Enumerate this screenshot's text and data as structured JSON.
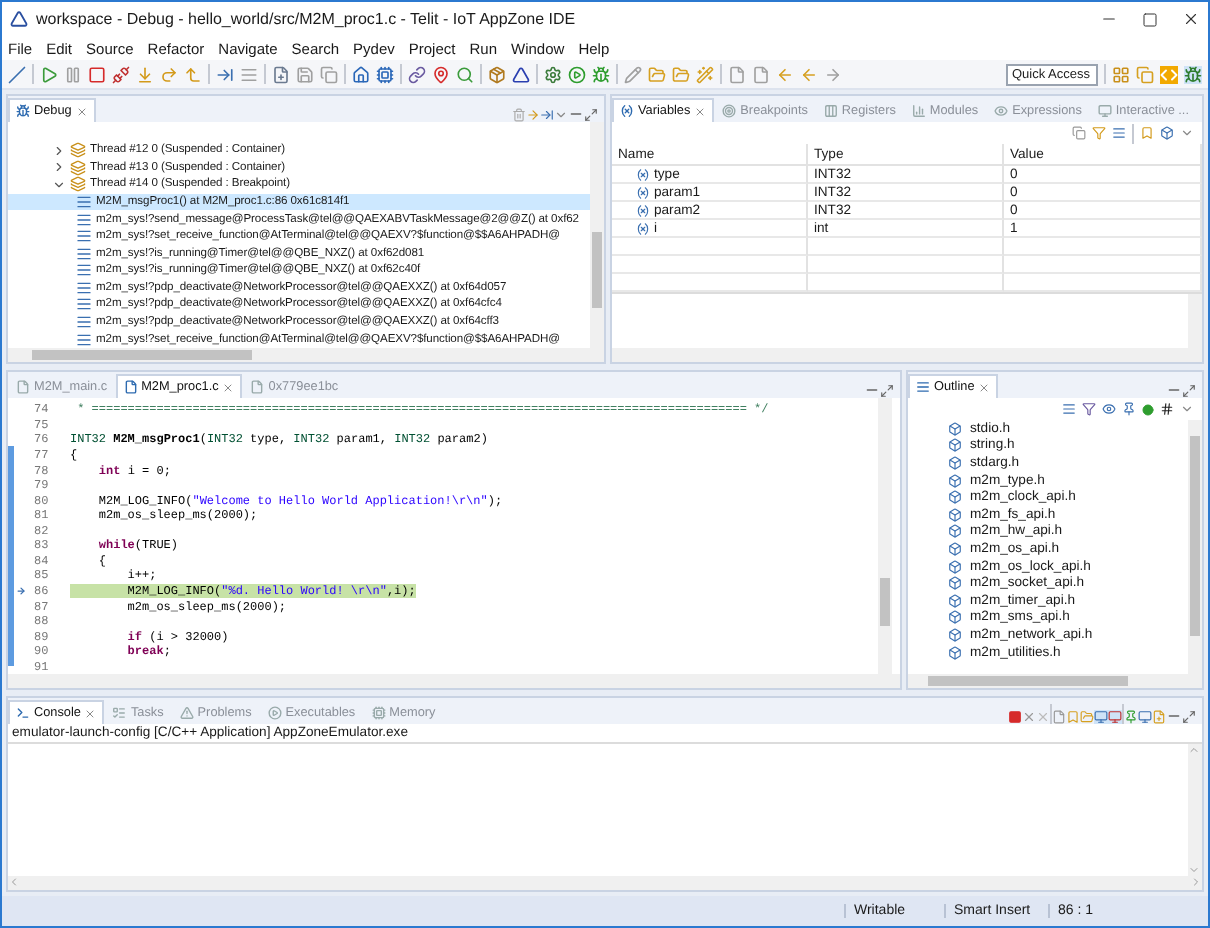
{
  "window": {
    "title": "workspace - Debug - hello_world/src/M2M_proc1.c - Telit - IoT AppZone IDE"
  },
  "menu": [
    "File",
    "Edit",
    "Source",
    "Refactor",
    "Navigate",
    "Search",
    "Pydev",
    "Project",
    "Run",
    "Window",
    "Help"
  ],
  "quick_access": {
    "placeholder": "Quick Access"
  },
  "debug_view": {
    "tabs": [
      {
        "label": "Debug",
        "selected": true
      }
    ],
    "threads": [
      {
        "label": "Thread #12 0 (Suspended : Container)",
        "expanded": false
      },
      {
        "label": "Thread #13 0 (Suspended : Container)",
        "expanded": false
      },
      {
        "label": "Thread #14 0 (Suspended : Breakpoint)",
        "expanded": true,
        "children": [
          {
            "label": "M2M_msgProc1() at M2M_proc1.c:86 0x61c814f1",
            "selected": true
          },
          {
            "label": "m2m_sys!?send_message@ProcessTask@tel@@QAEXABVTaskMessage@2@@Z() at 0xf62",
            "selected": false
          },
          {
            "label": "m2m_sys!?set_receive_function@AtTerminal@tel@@QAEXV?$function@$$A6AHPADH@",
            "selected": false
          },
          {
            "label": "m2m_sys!?is_running@Timer@tel@@QBE_NXZ() at 0xf62d081",
            "selected": false
          },
          {
            "label": "m2m_sys!?is_running@Timer@tel@@QBE_NXZ() at 0xf62c40f",
            "selected": false
          },
          {
            "label": "m2m_sys!?pdp_deactivate@NetworkProcessor@tel@@QAEXXZ() at 0xf64d057",
            "selected": false
          },
          {
            "label": "m2m_sys!?pdp_deactivate@NetworkProcessor@tel@@QAEXXZ() at 0xf64cfc4",
            "selected": false
          },
          {
            "label": "m2m_sys!?pdp_deactivate@NetworkProcessor@tel@@QAEXXZ() at 0xf64cff3",
            "selected": false
          },
          {
            "label": "m2m_sys!?set_receive_function@AtTerminal@tel@@QAEXV?$function@$$A6AHPADH@",
            "selected": false
          }
        ]
      }
    ]
  },
  "variables_view": {
    "tabs": [
      {
        "label": "Variables",
        "selected": true
      },
      {
        "label": "Breakpoints",
        "selected": false
      },
      {
        "label": "Registers",
        "selected": false
      },
      {
        "label": "Modules",
        "selected": false
      },
      {
        "label": "Expressions",
        "selected": false
      },
      {
        "label": "Interactive ...",
        "selected": false
      }
    ],
    "columns": [
      "Name",
      "Type",
      "Value"
    ],
    "rows": [
      {
        "name": "type",
        "type": "INT32",
        "value": "0"
      },
      {
        "name": "param1",
        "type": "INT32",
        "value": "0"
      },
      {
        "name": "param2",
        "type": "INT32",
        "value": "0"
      },
      {
        "name": "i",
        "type": "int",
        "value": "1"
      }
    ]
  },
  "editor": {
    "tabs": [
      {
        "label": "M2M_main.c",
        "selected": false
      },
      {
        "label": "M2M_proc1.c",
        "selected": true
      },
      {
        "label": "0x779ee1bc",
        "selected": false
      }
    ],
    "lines": [
      {
        "number": "74",
        "current": false,
        "segments": [
          {
            "text": " * =========================================================================================== */",
            "kind": "comment"
          }
        ]
      },
      {
        "number": "75",
        "current": false
      },
      {
        "number": "76",
        "current": false,
        "segments": [
          {
            "text": "INT32 ",
            "kind": "type"
          },
          {
            "text": "M2M_msgProc1",
            "kind": "bold"
          },
          {
            "text": "(",
            "kind": "plain"
          },
          {
            "text": "INT32",
            "kind": "type"
          },
          {
            "text": " type, ",
            "kind": "plain"
          },
          {
            "text": "INT32",
            "kind": "type"
          },
          {
            "text": " param1, ",
            "kind": "plain"
          },
          {
            "text": "INT32",
            "kind": "type"
          },
          {
            "text": " param2)",
            "kind": "plain"
          }
        ]
      },
      {
        "number": "77",
        "current": false,
        "segments": [
          {
            "text": "{",
            "kind": "plain"
          }
        ]
      },
      {
        "number": "78",
        "current": false,
        "segments": [
          {
            "text": "    int",
            "kind": "keyword"
          },
          {
            "text": " i = 0;",
            "kind": "plain"
          }
        ]
      },
      {
        "number": "79",
        "current": false
      },
      {
        "number": "80",
        "current": false,
        "segments": [
          {
            "text": "    M2M_LOG_INFO(",
            "kind": "plain"
          },
          {
            "text": "\"Welcome to Hello World Application!\\r\\n\"",
            "kind": "string"
          },
          {
            "text": ");",
            "kind": "plain"
          }
        ]
      },
      {
        "number": "81",
        "current": false,
        "segments": [
          {
            "text": "    m2m_os_sleep_ms(2000);",
            "kind": "plain"
          }
        ]
      },
      {
        "number": "82",
        "current": false
      },
      {
        "number": "83",
        "current": false,
        "segments": [
          {
            "text": "    while",
            "kind": "keyword"
          },
          {
            "text": "(TRUE)",
            "kind": "plain"
          }
        ]
      },
      {
        "number": "84",
        "current": false,
        "segments": [
          {
            "text": "    {",
            "kind": "plain"
          }
        ]
      },
      {
        "number": "85",
        "current": false,
        "segments": [
          {
            "text": "        i++;",
            "kind": "plain"
          }
        ]
      },
      {
        "number": "86",
        "current": true,
        "segments": [
          {
            "text": "        M2M_LOG_INFO(",
            "kind": "plain"
          },
          {
            "text": "\"%d. Hello World! \\r\\n\"",
            "kind": "string"
          },
          {
            "text": ",i);",
            "kind": "plain"
          }
        ]
      },
      {
        "number": "87",
        "current": false,
        "segments": [
          {
            "text": "        m2m_os_sleep_ms(2000);",
            "kind": "plain"
          }
        ]
      },
      {
        "number": "88",
        "current": false
      },
      {
        "number": "89",
        "current": false,
        "segments": [
          {
            "text": "        if",
            "kind": "keyword"
          },
          {
            "text": " (i > 32000)",
            "kind": "plain"
          }
        ]
      },
      {
        "number": "90",
        "current": false,
        "segments": [
          {
            "text": "        break",
            "kind": "keyword"
          },
          {
            "text": ";",
            "kind": "plain"
          }
        ]
      },
      {
        "number": "91",
        "current": false
      }
    ]
  },
  "outline": {
    "tabs": [
      {
        "label": "Outline",
        "selected": true
      }
    ],
    "items": [
      "stdio.h",
      "string.h",
      "stdarg.h",
      "m2m_type.h",
      "m2m_clock_api.h",
      "m2m_fs_api.h",
      "m2m_hw_api.h",
      "m2m_os_api.h",
      "m2m_os_lock_api.h",
      "m2m_socket_api.h",
      "m2m_timer_api.h",
      "m2m_sms_api.h",
      "m2m_network_api.h",
      "m2m_utilities.h"
    ]
  },
  "console": {
    "tabs": [
      {
        "label": "Console",
        "selected": true
      },
      {
        "label": "Tasks",
        "selected": false
      },
      {
        "label": "Problems",
        "selected": false
      },
      {
        "label": "Executables",
        "selected": false
      },
      {
        "label": "Memory",
        "selected": false
      }
    ],
    "launch": "emulator-launch-config [C/C++ Application] AppZoneEmulator.exe"
  },
  "status_bar": [
    "Writable",
    "Smart Insert",
    "86 : 1"
  ]
}
